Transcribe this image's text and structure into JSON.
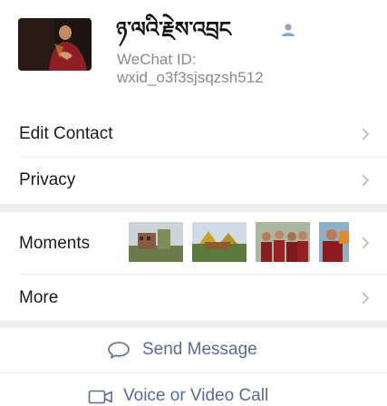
{
  "profile": {
    "name": "ཉ་ལའི་རྗེས་འབྲང",
    "wechat_id_label": "WeChat ID:",
    "wechat_id_value": "wxid_o3f3sjsqzsh512",
    "avatar_icon": "contact-photo",
    "badge_icon": "person-icon"
  },
  "menu": {
    "edit_contact": "Edit Contact",
    "privacy": "Privacy",
    "moments": "Moments",
    "more": "More"
  },
  "actions": {
    "send_message": "Send Message",
    "voice_video_call": "Voice or Video Call"
  },
  "colors": {
    "link": "#576b95",
    "section_gap": "#ededed",
    "secondary_text": "#8a8a8a"
  }
}
